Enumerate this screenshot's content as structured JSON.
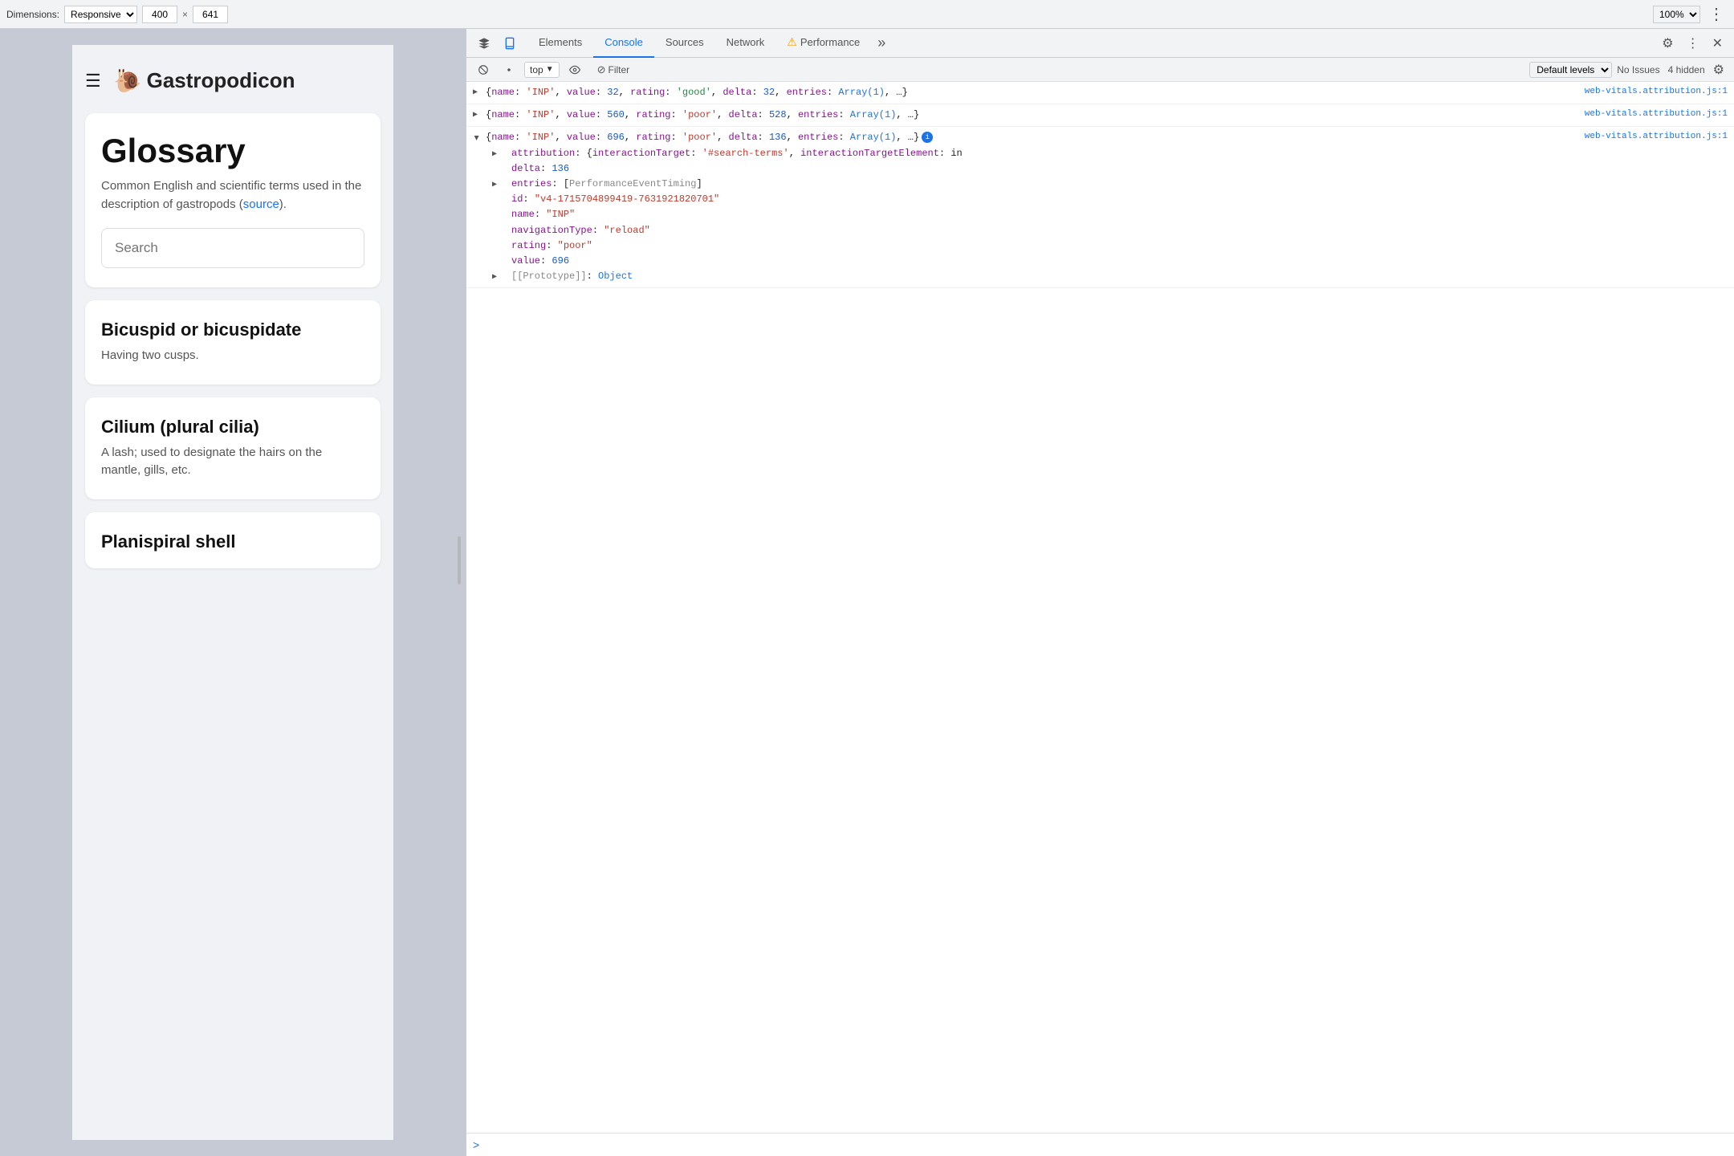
{
  "topbar": {
    "dimensions_label": "Dimensions:",
    "responsive_label": "Responsive",
    "width_value": "400",
    "height_value": "641",
    "zoom_value": "100%",
    "more_btn": "⋮"
  },
  "preview": {
    "site_title": "Gastropodicon",
    "snail": "🐌",
    "glossary_title": "Glossary",
    "glossary_desc_pre": "Common English and scientific terms used in the description of gastropods (",
    "glossary_desc_link": "source",
    "glossary_desc_post": ").",
    "search_placeholder": "Search",
    "terms": [
      {
        "title": "Bicuspid or bicuspidate",
        "desc": "Having two cusps."
      },
      {
        "title": "Cilium (plural cilia)",
        "desc": "A lash; used to designate the hairs on the mantle, gills, etc."
      },
      {
        "title": "Planispiral shell",
        "desc": ""
      }
    ]
  },
  "devtools": {
    "tabs": [
      {
        "id": "elements",
        "label": "Elements",
        "active": false
      },
      {
        "id": "console",
        "label": "Console",
        "active": true
      },
      {
        "id": "sources",
        "label": "Sources",
        "active": false
      },
      {
        "id": "network",
        "label": "Network",
        "active": false
      },
      {
        "id": "performance",
        "label": "Performance",
        "active": false,
        "warning": true
      }
    ],
    "more_tabs": "»",
    "console_bar": {
      "top_context": "top",
      "filter_label": "Filter",
      "levels_label": "Default levels",
      "no_issues": "No Issues",
      "hidden_label": "4 hidden"
    },
    "console_entries": [
      {
        "id": "entry1",
        "source_link": "web-vitals.attribution.js:1",
        "expanded": false,
        "content_collapsed": "{name: 'INP', value: 32, rating: 'good', delta: 32, entries: Array(1), …}"
      },
      {
        "id": "entry2",
        "source_link": "web-vitals.attribution.js:1",
        "expanded": false,
        "content_collapsed": "{name: 'INP', value: 560, rating: 'poor', delta: 528, entries: Array(1), …}"
      },
      {
        "id": "entry3",
        "source_link": "web-vitals.attribution.js:1",
        "expanded": true,
        "content_collapsed": "{name: 'INP', value: 696, rating: 'poor', delta: 136, entries: Array(1), …}",
        "children": [
          {
            "key": "attribution",
            "value_preview": "{interactionTarget: '#search-terms', interactionTargetElement: in",
            "expanded": false
          },
          {
            "key": "delta",
            "value": "136",
            "type": "number"
          },
          {
            "key": "entries",
            "value": "[PerformanceEventTiming]",
            "expanded": false
          },
          {
            "key": "id",
            "value": "\"v4-1715704899419-7631921820701\"",
            "type": "string"
          },
          {
            "key": "name",
            "value": "\"INP\"",
            "type": "string"
          },
          {
            "key": "navigationType",
            "value": "\"reload\"",
            "type": "string"
          },
          {
            "key": "rating",
            "value": "\"poor\"",
            "type": "string"
          },
          {
            "key": "value",
            "value": "696",
            "type": "number"
          },
          {
            "key": "[[Prototype]]",
            "value": "Object",
            "type": "proto"
          }
        ]
      }
    ],
    "prompt_chevron": ">"
  }
}
